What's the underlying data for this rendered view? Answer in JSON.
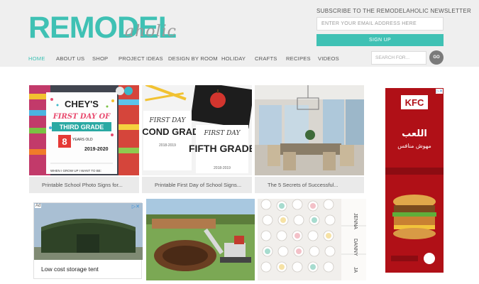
{
  "logo": {
    "main": "REMODEL",
    "script": "aholic"
  },
  "newsletter": {
    "title": "SUBSCRIBE TO THE REMODELAHOLIC NEWSLETTER",
    "email_placeholder": "ENTER YOUR EMAIL ADDRESS HERE",
    "signup_label": "SIGN UP"
  },
  "nav": {
    "items": [
      "HOME",
      "ABOUT US",
      "SHOP",
      "PROJECT IDEAS",
      "DESIGN BY ROOM",
      "HOLIDAY",
      "CRAFTS",
      "RECIPES",
      "VIDEOS"
    ],
    "active": "HOME"
  },
  "search": {
    "placeholder": "SEARCH FOR...",
    "go_label": "GO"
  },
  "posts": [
    {
      "caption": "Printable School Photo Signs for..."
    },
    {
      "caption": "Printable First Day of School Signs..."
    },
    {
      "caption": "The 5 Secrets of Successful..."
    }
  ],
  "thumb_text": {
    "chey_name": "CHEY'S",
    "chey_line1": "FIRST DAY OF",
    "chey_grade": "THIRD GRADE",
    "chey_age": "8",
    "chey_years": "YEARS OLD",
    "chey_year": "2019-2020",
    "chey_bottom": "WHEN I GROW UP I WANT TO BE:",
    "sign1_top": "FIRST DAY",
    "sign1_big": "SECOND GRADE",
    "sign1_year": "2018-2019",
    "sign2_top": "FIRST DAY",
    "sign2_big": "FIFTH GRADE",
    "sign2_year": "2018-2019",
    "name_jenna": "JENNA",
    "name_danny": "DANNY",
    "name_ja": "JA"
  },
  "ad_left": {
    "badge": "Ad",
    "title": "Low cost storage tent"
  },
  "ad_right": {
    "brand": "KFC",
    "arabic_line1": "اللعب",
    "arabic_line2": "مهوش منافس"
  }
}
